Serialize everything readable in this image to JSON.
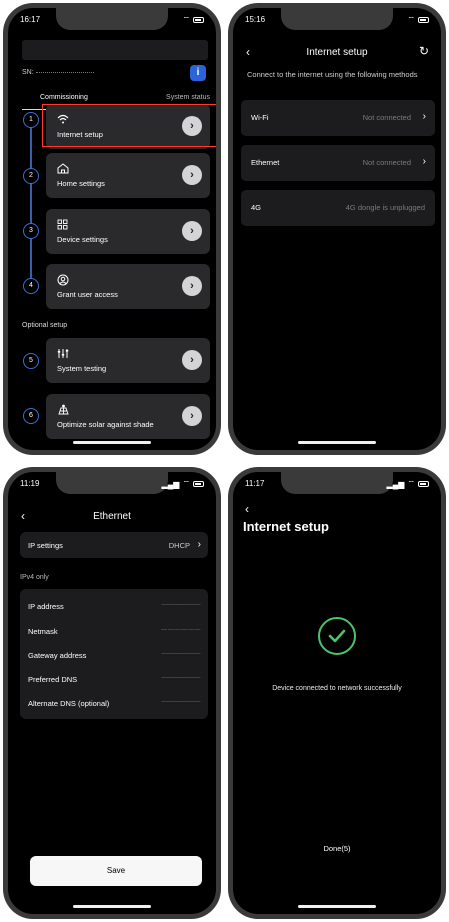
{
  "phone1": {
    "time": "16:17",
    "sn_label": "SN:",
    "info_label": "i",
    "tabs": [
      "Commissioning",
      "System status"
    ],
    "steps": [
      {
        "num": "1",
        "label": "Internet setup",
        "icon": "wifi-icon"
      },
      {
        "num": "2",
        "label": "Home settings",
        "icon": "home-icon"
      },
      {
        "num": "3",
        "label": "Device settings",
        "icon": "grid-icon"
      },
      {
        "num": "4",
        "label": "Grant user access",
        "icon": "user-icon"
      }
    ],
    "optional_label": "Optional setup",
    "optional_steps": [
      {
        "num": "5",
        "label": "System testing",
        "icon": "sliders-icon"
      },
      {
        "num": "6",
        "label": "Optimize solar against shade",
        "icon": "solar-panel-icon"
      }
    ]
  },
  "phone2": {
    "time": "15:16",
    "title": "Internet setup",
    "description": "Connect to the internet using the following methods",
    "rows": [
      {
        "label": "Wi-Fi",
        "status": "Not connected"
      },
      {
        "label": "Ethernet",
        "status": "Not connected"
      },
      {
        "label": "4G",
        "status": "4G dongle is unplugged"
      }
    ]
  },
  "phone3": {
    "time": "11:19",
    "title": "Ethernet",
    "ip_settings_label": "IP settings",
    "ip_settings_value": "DHCP",
    "ipv4_label": "IPv4 only",
    "fields": [
      {
        "label": "IP address",
        "value": "———————"
      },
      {
        "label": "Netmask",
        "value": "— — — — — —"
      },
      {
        "label": "Gateway address",
        "value": "———————"
      },
      {
        "label": "Preferred DNS",
        "value": "———————"
      },
      {
        "label": "Alternate DNS (optional)",
        "value": "———————"
      }
    ],
    "save_label": "Save"
  },
  "phone4": {
    "time": "11:17",
    "title": "Internet setup",
    "success_text": "Device connected to network successfully",
    "done_label": "Done(5)"
  },
  "colors": {
    "accent_blue": "#2b64d8",
    "success_green": "#4bc46a",
    "highlight_red": "#ff3b30"
  }
}
